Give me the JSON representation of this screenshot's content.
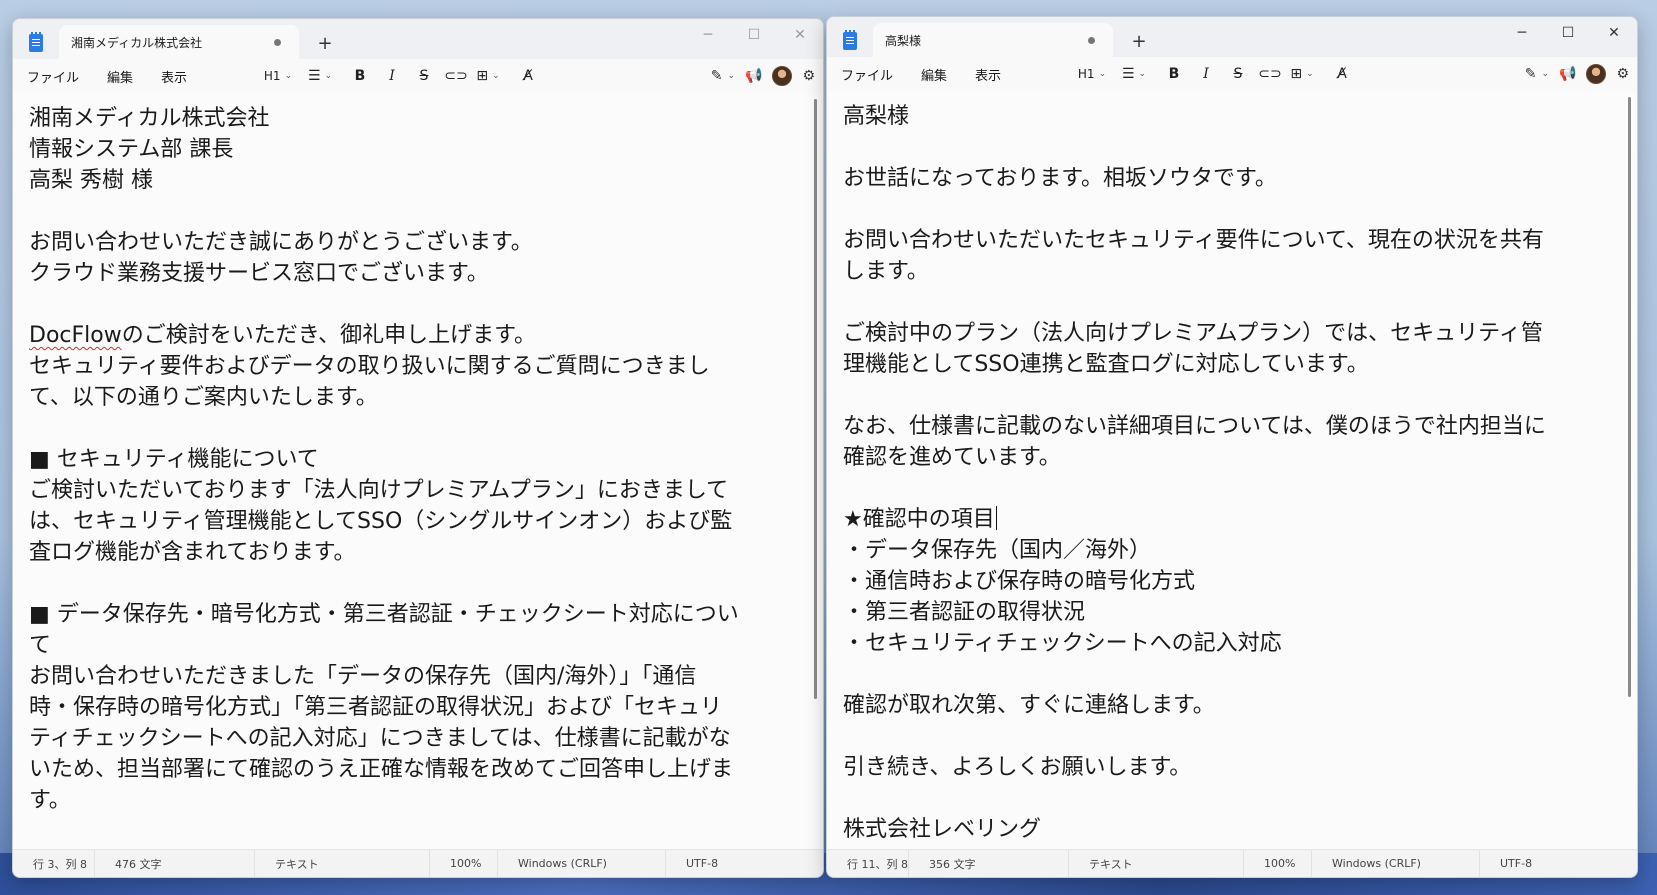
{
  "app": {
    "menu": [
      "ファイル",
      "編集",
      "表示"
    ],
    "heading_label": "H1",
    "new_tab_label": "+",
    "window_controls": {
      "minimize": "─",
      "maximize": "☐",
      "close": "✕"
    }
  },
  "left": {
    "tab_title": "湘南メディカル株式会社",
    "lines": [
      "湘南メディカル株式会社",
      "情報システム部 課長",
      "高梨 秀樹 様",
      "",
      "お問い合わせいただき誠にありがとうございます。",
      "クラウド業務支援サービス窓口でございます。",
      "",
      "DocFlow|のご検討をいただき、御礼申し上げます。",
      "セキュリティ要件およびデータの取り扱いに関するご質問につきまし",
      "て、以下の通りご案内いたします。",
      "",
      "■ セキュリティ機能について",
      "ご検討いただいております「法人向けプレミアムプラン」におきまして",
      "は、セキュリティ管理機能としてSSO（シングルサインオン）および監",
      "査ログ機能が含まれております。",
      "",
      "■ データ保存先・暗号化方式・第三者認証・チェックシート対応につい",
      "て",
      "お問い合わせいただきました「データの保存先（国内/海外）」「通信",
      "時・保存時の暗号化方式」「第三者認証の取得状況」および「セキュリ",
      "ティチェックシートへの記入対応」につきましては、仕様書に記載がな",
      "いため、担当部署にて確認のうえ正確な情報を改めてご回答申し上げま",
      "す。"
    ],
    "status": {
      "position": "行 3、列 8",
      "chars": "476 文字",
      "format": "テキスト",
      "zoom": "100%",
      "line_ending": "Windows (CRLF)",
      "encoding": "UTF-8"
    }
  },
  "right": {
    "tab_title": "高梨様",
    "lines": [
      "高梨様",
      "",
      "お世話になっております。相坂ソウタです。",
      "",
      "お問い合わせいただいたセキュリティ要件について、現在の状況を共有",
      "します。",
      "",
      "ご検討中のプラン（法人向けプレミアムプラン）では、セキュリティ管",
      "理機能としてSSO連携と監査ログに対応しています。",
      "",
      "なお、仕様書に記載のない詳細項目については、僕のほうで社内担当に",
      "確認を進めています。",
      "",
      "★確認中の項目",
      "・データ保存先（国内／海外）",
      "・通信時および保存時の暗号化方式",
      "・第三者認証の取得状況",
      "・セキュリティチェックシートへの記入対応",
      "",
      "確認が取れ次第、すぐに連絡します。",
      "",
      "引き続き、よろしくお願いします。",
      "",
      "株式会社レベリング"
    ],
    "status": {
      "position": "行 11、列 8",
      "chars": "356 文字",
      "format": "テキスト",
      "zoom": "100%",
      "line_ending": "Windows (CRLF)",
      "encoding": "UTF-8"
    }
  }
}
